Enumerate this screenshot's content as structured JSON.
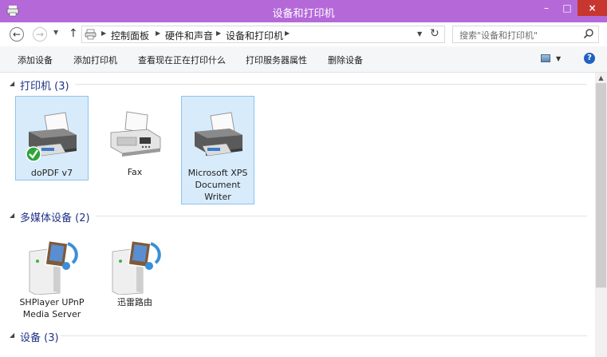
{
  "window": {
    "title": "设备和打印机",
    "minimize": "–",
    "maximize": "□",
    "close": "×"
  },
  "nav": {
    "back": "←",
    "forward": "→",
    "up": "↑",
    "breadcrumbs": [
      "控制面板",
      "硬件和声音",
      "设备和打印机"
    ],
    "search_placeholder": "搜索\"设备和打印机\""
  },
  "commands": [
    "添加设备",
    "添加打印机",
    "查看现在正在打印什么",
    "打印服务器属性",
    "删除设备"
  ],
  "help": "?",
  "groups": [
    {
      "name": "打印机 (3)",
      "items": [
        {
          "label": "doPDF v7",
          "icon": "printer-default-icon",
          "selected": true
        },
        {
          "label": "Fax",
          "icon": "fax-icon",
          "selected": false
        },
        {
          "label": "Microsoft XPS Document Writer",
          "icon": "printer-icon",
          "selected": true
        }
      ]
    },
    {
      "name": "多媒体设备 (2)",
      "items": [
        {
          "label": "SHPlayer UPnP Media Server",
          "icon": "media-server-icon"
        },
        {
          "label": "迅雷路由",
          "icon": "media-server-icon"
        }
      ]
    },
    {
      "name": "设备 (3)",
      "items": []
    }
  ],
  "colors": {
    "titlebar": "#b569d9",
    "close": "#c7372f",
    "group_title": "#1e3287",
    "selection": "#d8ebfb"
  }
}
